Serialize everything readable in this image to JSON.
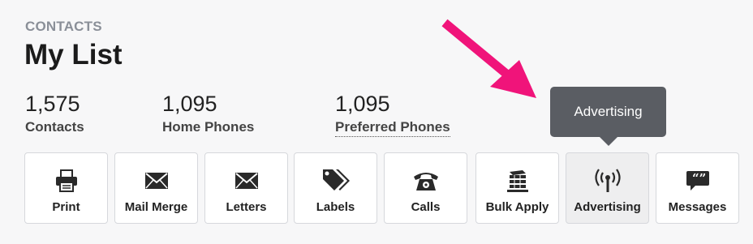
{
  "header": {
    "section_label": "CONTACTS",
    "title": "My List"
  },
  "stats": [
    {
      "value": "1,575",
      "label": "Contacts"
    },
    {
      "value": "1,095",
      "label": "Home Phones"
    },
    {
      "value": "1,095",
      "label": "Preferred Phones"
    }
  ],
  "actions": [
    {
      "label": "Print",
      "icon": "printer-icon"
    },
    {
      "label": "Mail Merge",
      "icon": "envelope-icon"
    },
    {
      "label": "Letters",
      "icon": "envelope-icon"
    },
    {
      "label": "Labels",
      "icon": "tags-icon"
    },
    {
      "label": "Calls",
      "icon": "phone-icon"
    },
    {
      "label": "Bulk Apply",
      "icon": "stack-icon"
    },
    {
      "label": "Advertising",
      "icon": "broadcast-icon"
    },
    {
      "label": "Messages",
      "icon": "quote-bubble-icon"
    }
  ],
  "tooltip": {
    "text": "Advertising"
  },
  "colors": {
    "annotation_arrow": "#f0147a",
    "tooltip_bg": "#5a5d63"
  }
}
